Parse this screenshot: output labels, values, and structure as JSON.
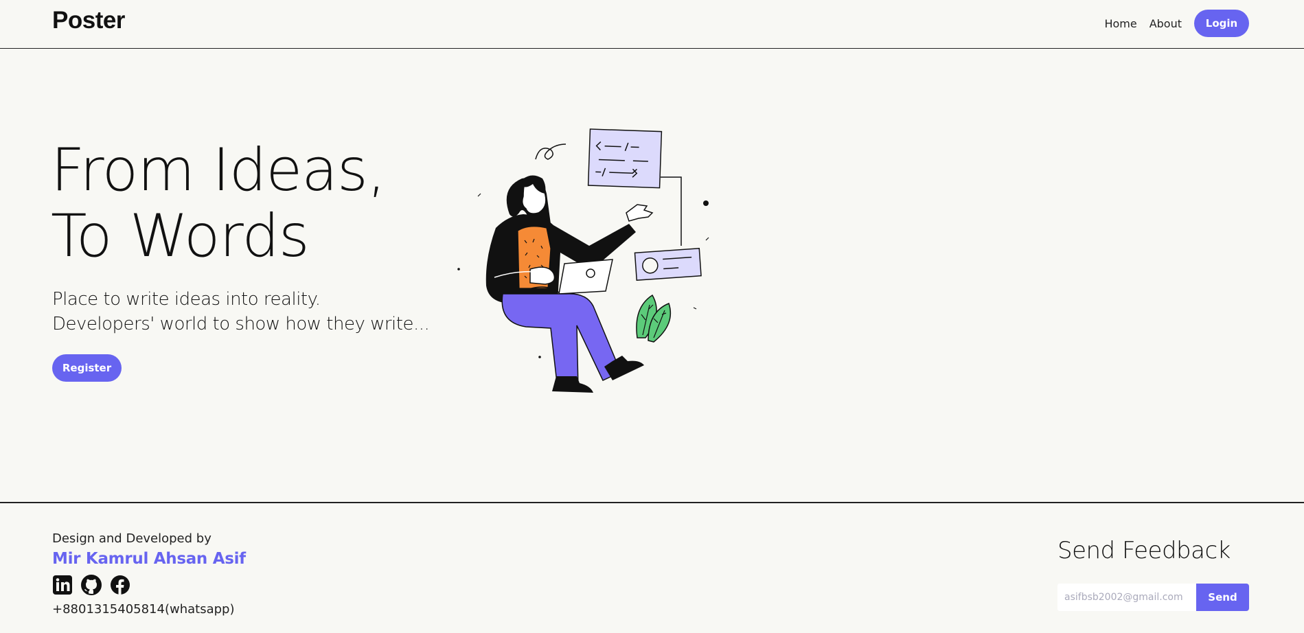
{
  "navbar": {
    "logo": "Poster",
    "links": [
      "Home",
      "About"
    ],
    "login_label": "Login"
  },
  "hero": {
    "title_line1": "From Ideas,",
    "title_line2": "To Words",
    "subtitle_line1": "Place to write ideas into reality.",
    "subtitle_line2": "Developers' world to show how they write...",
    "register_label": "Register",
    "illustration_icon": "woman-with-laptop-illustration"
  },
  "footer": {
    "credit_label": "Design and Developed by",
    "credit_name": "Mir Kamrul Ahsan Asif",
    "social_icons": [
      "linkedin-icon",
      "github-icon",
      "facebook-icon"
    ],
    "phone": "+8801315405814(whatsapp)",
    "feedback_title": "Send Feedback",
    "feedback_placeholder": "asifbsb2002@gmail.com",
    "send_label": "Send"
  },
  "colors": {
    "accent": "#6764f0",
    "background": "#f8f8f4"
  }
}
